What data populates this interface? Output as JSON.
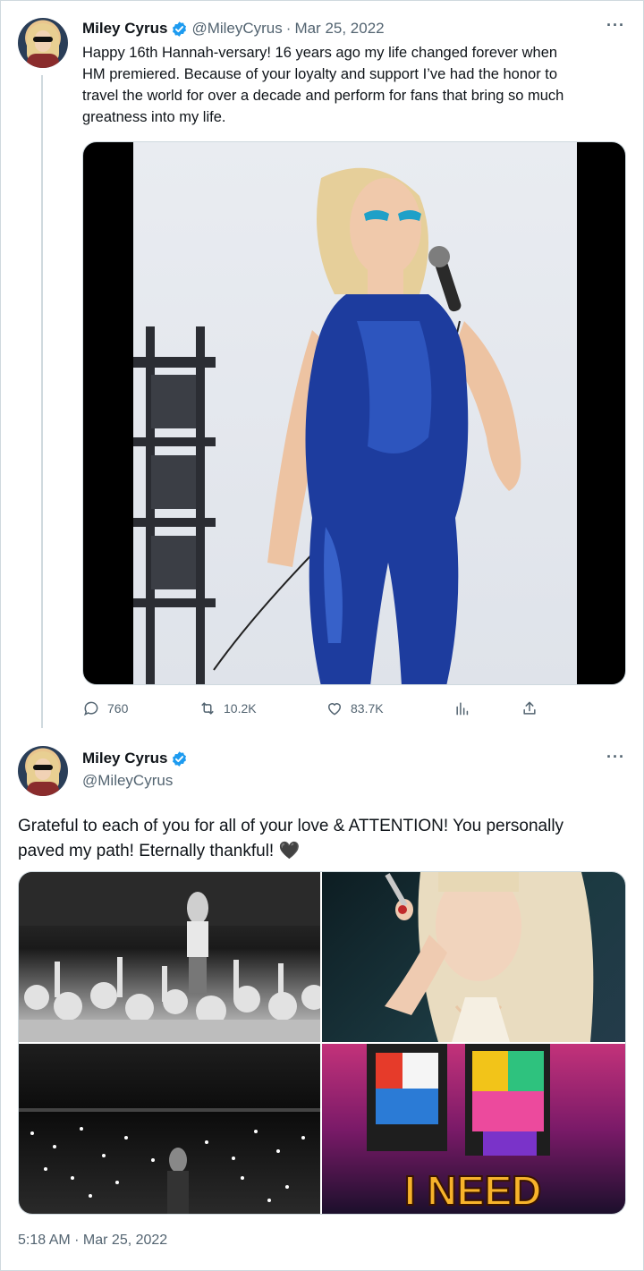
{
  "tweet1": {
    "name": "Miley Cyrus",
    "handle": "@MileyCyrus",
    "separator": "·",
    "date": "Mar 25, 2022",
    "more": "···",
    "text_lines": [
      "Happy 16th Hannah-versary! 16 years ago my life changed forever when",
      "HM premiered. Because of your loyalty and support I’ve had the honor to",
      "travel the world for over a decade and perform for fans that bring so much",
      "greatness into my life."
    ],
    "replies": "760",
    "retweets": "10.2K",
    "likes": "83.7K"
  },
  "tweet2": {
    "name": "Miley Cyrus",
    "handle": "@MileyCyrus",
    "more": "···",
    "text_lines": [
      "Grateful to each of you for all of your love & ATTENTION! You personally",
      "paved my path! Eternally thankful! 🖤"
    ],
    "media_text": "I NEED",
    "timestamp": "5:18 AM · Mar 25, 2022"
  },
  "colors": {
    "verified": "#1d9bf0",
    "text": "#0f1419",
    "secondary": "#536471",
    "border": "#cfd9de"
  }
}
